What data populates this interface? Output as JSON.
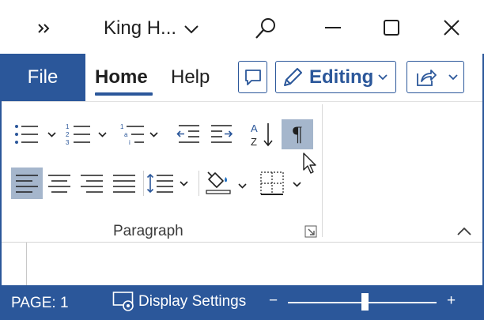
{
  "window": {
    "title": "King H...",
    "overflow_icon": "chevron-double-right-icon",
    "title_menu_icon": "chevron-down-icon",
    "search_icon": "search-icon",
    "controls": [
      "minimize-icon",
      "maximize-icon",
      "close-icon"
    ]
  },
  "tabs": {
    "file": "File",
    "home": "Home",
    "help": "Help",
    "active": "Home"
  },
  "toolbar": {
    "comments_icon": "comment-icon",
    "editing_label": "Editing",
    "editing_icon": "pencil-icon",
    "share_icon": "share-icon"
  },
  "ribbon": {
    "group_label": "Paragraph",
    "row1": [
      "bullets-icon",
      "numbering-icon",
      "multilevel-list-icon",
      "decrease-indent-icon",
      "increase-indent-icon",
      "sort-icon",
      "show-formatting-marks-icon"
    ],
    "row2": [
      "align-left-icon",
      "align-center-icon",
      "align-right-icon",
      "justify-icon",
      "line-spacing-icon",
      "shading-icon",
      "borders-icon"
    ],
    "active_buttons": [
      "show-formatting-marks",
      "align-left"
    ],
    "pilcrow": "¶",
    "sort_glyph_a": "A",
    "sort_glyph_z": "Z",
    "number_glyphs": [
      "1",
      "2",
      "3"
    ],
    "multilevel_glyphs": [
      "1",
      "a",
      "i"
    ]
  },
  "status": {
    "page": "PAGE: 1",
    "display_settings": "Display Settings",
    "zoom_minus": "−",
    "zoom_plus": "+",
    "zoom_level_fraction": 0.52
  },
  "colors": {
    "brand": "#2b579a",
    "active_button": "#a5b6cc",
    "shading_accent": "#1f6fc1"
  }
}
